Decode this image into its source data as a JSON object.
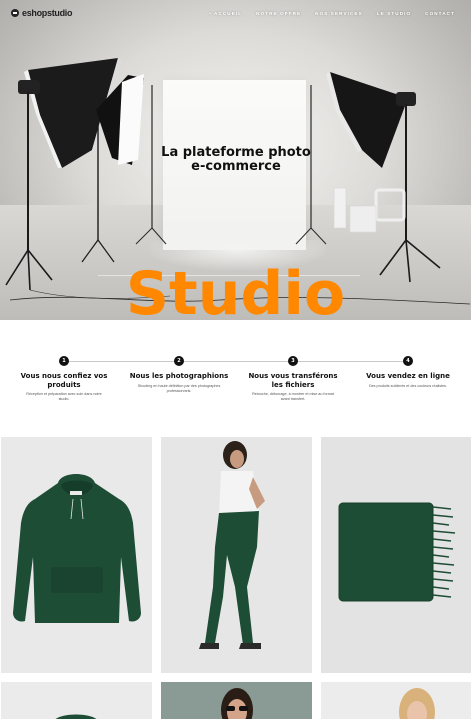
{
  "brand": {
    "logo_text": "eshopstudio"
  },
  "nav": {
    "items": [
      "• ACCUEIL",
      "NOTRE OFFRE",
      "NOS SERVICES",
      "LE STUDIO",
      "CONTACT"
    ]
  },
  "hero": {
    "title_line1": "La plateforme photo",
    "title_line2": "e-commerce",
    "big_word": "Studio",
    "accent_color": "#ff8800"
  },
  "steps": [
    {
      "number": "1",
      "title": "Vous nous confiez vos produits",
      "desc": "Réception et préparation avec soin dans notre studio."
    },
    {
      "number": "2",
      "title": "Nous les photographions",
      "desc": "Shooting en haute définition par des photographes professionnels."
    },
    {
      "number": "3",
      "title": "Nous vous transférons les fichiers",
      "desc": "Retouche, détourage, à montrer et mise au format avant transfert."
    },
    {
      "number": "4",
      "title": "Vous vendez en ligne",
      "desc": "Des produits sublimés et des couleurs réalistes."
    }
  ],
  "products": {
    "product_color": "#1e4d36",
    "items": [
      "hoodie",
      "model-jeans",
      "scarf",
      "sweater",
      "model-sunglasses",
      "model-blonde"
    ]
  }
}
